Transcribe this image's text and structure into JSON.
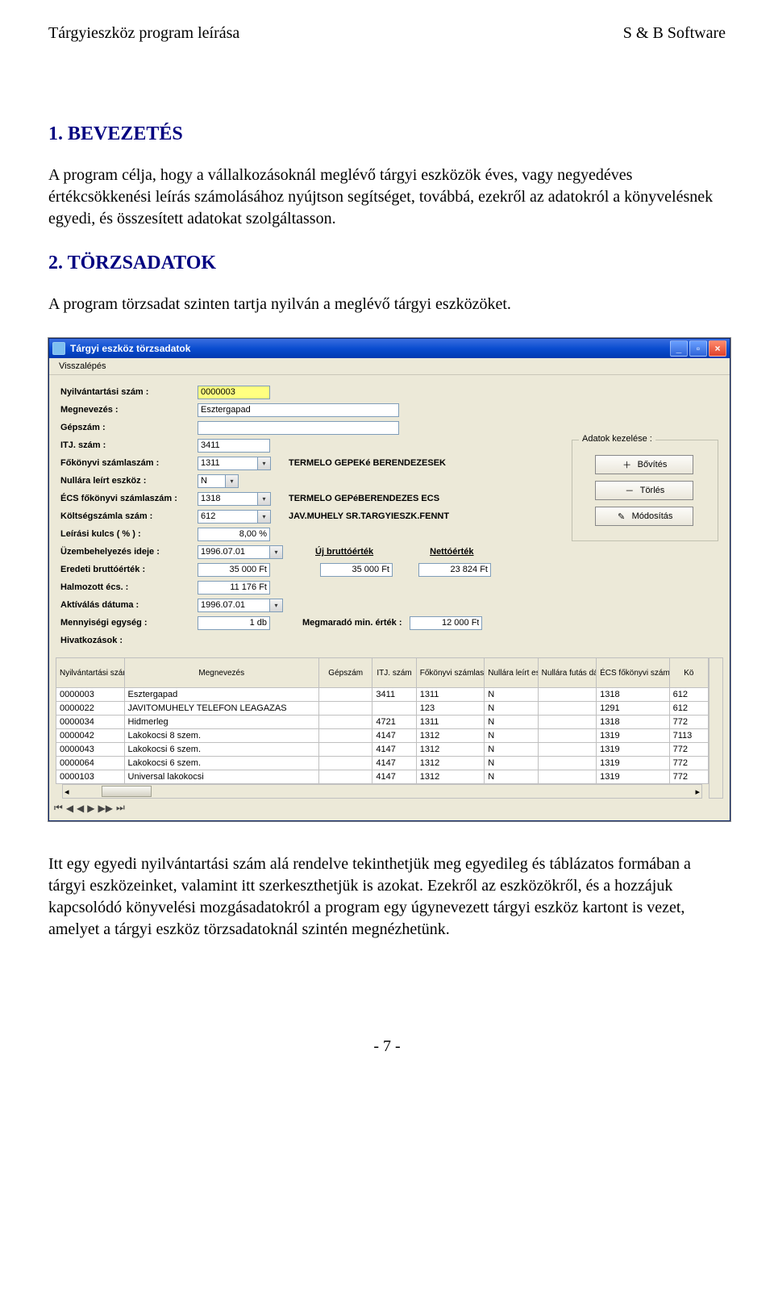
{
  "header": {
    "left": "Tárgyieszköz program leírása",
    "right": "S & B Software"
  },
  "section1": {
    "title": "1. BEVEZETÉS",
    "paragraph": "A program célja, hogy a vállalkozásoknál meglévő tárgyi eszközök éves, vagy negyedéves értékcsökkenési leírás számolásához nyújtson segítséget, továbbá, ezekről az adatokról a könyvelésnek egyedi, és összesített adatokat szolgáltasson."
  },
  "section2": {
    "title": "2. TÖRZSADATOK",
    "intro": "A program törzsadat szinten tartja nyilván a meglévő tárgyi eszközöket.",
    "outro": "Itt egy egyedi nyilvántartási szám alá rendelve tekinthetjük meg egyedileg és táblázatos formában a tárgyi eszközeinket, valamint itt szerkeszthetjük is azokat. Ezekről az eszközökről, és a hozzájuk kapcsolódó könyvelési mozgásadatokról a program egy úgynevezett tárgyi eszköz kartont is vezet, amelyet a tárgyi eszköz törzsadatoknál szintén megnézhetünk."
  },
  "window": {
    "title": "Tárgyi eszköz törzsadatok",
    "menu": "Visszalépés",
    "panel_title": "Adatok kezelése :",
    "actions": {
      "add": "Bővítés",
      "delete": "Törlés",
      "modify": "Módosítás"
    }
  },
  "form": {
    "labels": {
      "nyilv": "Nyilvántartási szám :",
      "megnev": "Megnevezés :",
      "gepszam": "Gépszám :",
      "itj": "ITJ. szám :",
      "fokonyvi": "Főkönyvi számlaszám :",
      "nullara": "Nullára leírt eszköz :",
      "ecs": "ÉCS főkönyvi számlaszám :",
      "koltseg": "Költségszámla szám :",
      "leirasi": "Leírási kulcs ( % ) :",
      "uzembe": "Üzembehelyezés ideje :",
      "eredeti": "Eredeti bruttóérték :",
      "halmozott": "Halmozott écs. :",
      "aktivalas": "Aktíválás dátuma :",
      "mennyiseg": "Mennyiségi egység :",
      "hivatk": "Hivatkozások :",
      "uj_brutto": "Új bruttóérték",
      "netto": "Nettóérték",
      "megmarado": "Megmaradó min. érték :"
    },
    "values": {
      "nyilv": "0000003",
      "megnev": "Esztergapad",
      "gepszam": "",
      "itj": "3411",
      "fokonyvi": "1311",
      "fokonyvi_text": "TERMELO GEPEKé BERENDEZESEK",
      "nullara": "N",
      "ecs": "1318",
      "ecs_text1": "TERMELO GEPéBERENDEZES ECS",
      "ecs_text2": "JAV.MUHELY SR.TARGYIESZK.FENNT",
      "koltseg": "612",
      "leirasi": "8,00 %",
      "uzembe": "1996.07.01",
      "eredeti": "35 000 Ft",
      "uj_brutto_val": "35 000 Ft",
      "netto_val": "23 824 Ft",
      "halmozott": "11 176 Ft",
      "aktivalas": "1996.07.01",
      "mennyiseg": "1 db",
      "megmarado_val": "12 000 Ft",
      "hivatk": ""
    }
  },
  "grid": {
    "headers": [
      "Nyilvántartási szám",
      "Megnevezés",
      "Gépszám",
      "ITJ. szám",
      "Főkönyvi számlaszám",
      "Nullára leírt eszköz",
      "Nullára futás dátuma",
      "ÉCS főkönyvi számlaszám",
      "Kö"
    ],
    "rows": [
      [
        "0000003",
        "Esztergapad",
        "",
        "3411",
        "1311",
        "N",
        "",
        "1318",
        "612"
      ],
      [
        "0000022",
        "JAVITOMUHELY TELEFON LEAGAZAS",
        "",
        "",
        "123",
        "N",
        "",
        "1291",
        "612"
      ],
      [
        "0000034",
        "Hidmerleg",
        "",
        "4721",
        "1311",
        "N",
        "",
        "1318",
        "772"
      ],
      [
        "0000042",
        "Lakokocsi 8 szem.",
        "",
        "4147",
        "1312",
        "N",
        "",
        "1319",
        "7113"
      ],
      [
        "0000043",
        "Lakokocsi 6 szem.",
        "",
        "4147",
        "1312",
        "N",
        "",
        "1319",
        "772"
      ],
      [
        "0000064",
        "Lakokocsi 6 szem.",
        "",
        "4147",
        "1312",
        "N",
        "",
        "1319",
        "772"
      ],
      [
        "0000103",
        "Universal lakokocsi",
        "",
        "4147",
        "1312",
        "N",
        "",
        "1319",
        "772"
      ]
    ],
    "nav": [
      "⏮",
      "◀",
      "◀",
      "▶",
      "▶▶",
      "⏭"
    ]
  },
  "footer": "- 7 -"
}
